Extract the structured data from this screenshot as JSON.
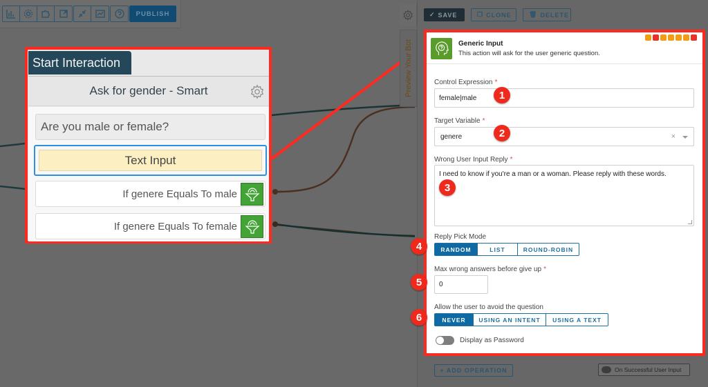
{
  "toolbar": {
    "icons": [
      "chart-icon",
      "gear-icon",
      "puzzle-icon",
      "export-icon",
      "collapse-icon",
      "analytics-icon",
      "help-icon"
    ],
    "publish_label": "PUBLISH"
  },
  "node": {
    "tab_label": "Start Interaction",
    "title": "Ask for gender - Smart",
    "question": "Are you male or female?",
    "input_block": "Text Input",
    "conditions": [
      {
        "label": "If genere Equals To male"
      },
      {
        "label": "If genere Equals To female"
      }
    ]
  },
  "preview_tab_label": "Preview Your Bot",
  "actions": {
    "save_label": "SAVE",
    "clone_label": "CLONE",
    "delete_label": "DELETE"
  },
  "form": {
    "title": "Generic Input",
    "description": "This action will ask for the user generic question.",
    "channel_colors": [
      "#f39c12",
      "#e5332a",
      "#f39c12",
      "#f39c12",
      "#f39c12",
      "#f39c12",
      "#e5332a"
    ],
    "control_expression": {
      "label": "Control Expression",
      "value": "female|male"
    },
    "target_variable": {
      "label": "Target Variable",
      "value": "genere"
    },
    "wrong_reply": {
      "label": "Wrong User Input Reply",
      "value": "I need to know if you're a man or a woman. Please reply with these words."
    },
    "reply_pick_mode": {
      "label": "Reply Pick Mode",
      "options": [
        "RANDOM",
        "LIST",
        "ROUND-ROBIN"
      ],
      "selected": "RANDOM"
    },
    "max_wrong": {
      "label": "Max wrong answers before give up",
      "value": "0"
    },
    "avoid_question": {
      "label": "Allow the user to avoid the question",
      "options": [
        "NEVER",
        "USING AN INTENT",
        "USING A TEXT"
      ],
      "selected": "NEVER"
    },
    "display_password": {
      "label": "Display as Password",
      "enabled": false
    },
    "required_mark": "*"
  },
  "badges": [
    "1",
    "2",
    "3",
    "4",
    "5",
    "6"
  ],
  "footer": {
    "add_operation_label": "+ ADD OPERATION",
    "on_success_label": "On Successful User Input"
  }
}
